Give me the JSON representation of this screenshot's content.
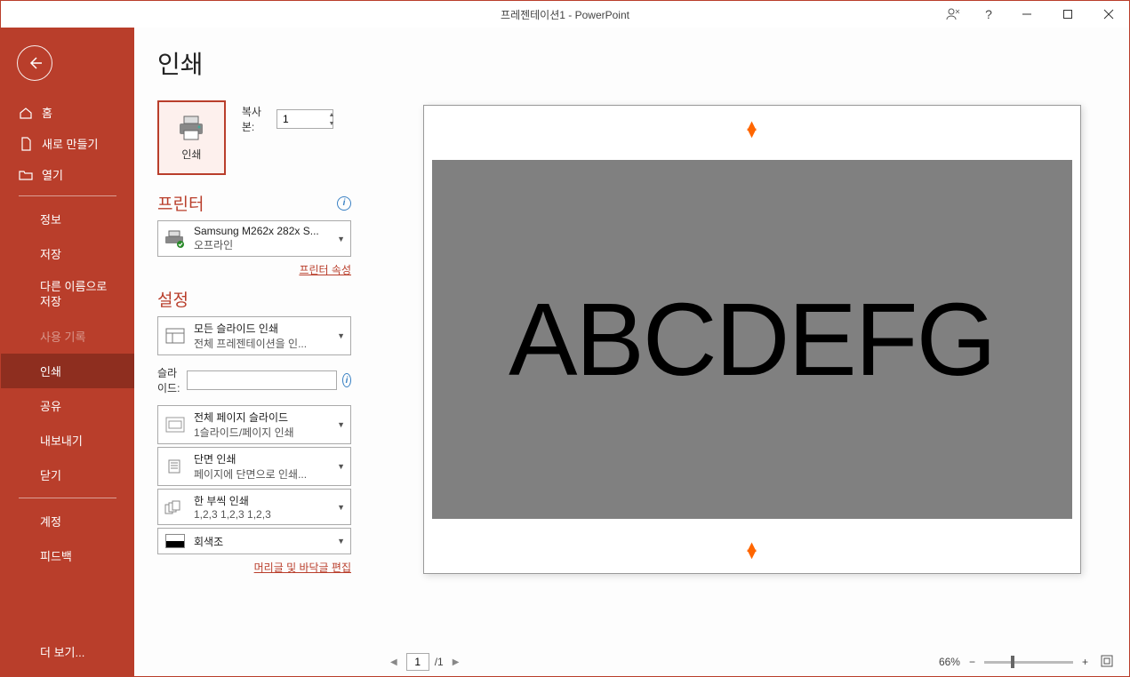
{
  "window": {
    "title": "프레젠테이션1  -  PowerPoint"
  },
  "sidebar": {
    "home": "홈",
    "new": "새로 만들기",
    "open": "열기",
    "info": "정보",
    "save": "저장",
    "save_as": "다른 이름으로 저장",
    "history": "사용 기록",
    "print": "인쇄",
    "share": "공유",
    "export": "내보내기",
    "close": "닫기",
    "account": "계정",
    "feedback": "피드백",
    "more": "더 보기..."
  },
  "print": {
    "title": "인쇄",
    "button_label": "인쇄",
    "copies_label": "복사본:",
    "copies_value": "1"
  },
  "printer": {
    "section": "프린터",
    "name": "Samsung M262x 282x S...",
    "status": "오프라인",
    "props_link": "프린터 속성"
  },
  "settings": {
    "section": "설정",
    "what": {
      "line1": "모든 슬라이드 인쇄",
      "line2": "전체 프레젠테이션을 인..."
    },
    "slides_label": "슬라이드:",
    "layout": {
      "line1": "전체 페이지 슬라이드",
      "line2": "1슬라이드/페이지 인쇄"
    },
    "sides": {
      "line1": "단면 인쇄",
      "line2": "페이지에 단면으로 인쇄..."
    },
    "collate": {
      "line1": "한 부씩 인쇄",
      "line2": "1,2,3     1,2,3     1,2,3"
    },
    "color": {
      "line1": "회색조"
    },
    "header_footer_link": "머리글 및 바닥글 편집"
  },
  "preview": {
    "slide_text": "ABCDEFG",
    "current_page": "1",
    "total_pages": "/1",
    "zoom": "66%"
  }
}
